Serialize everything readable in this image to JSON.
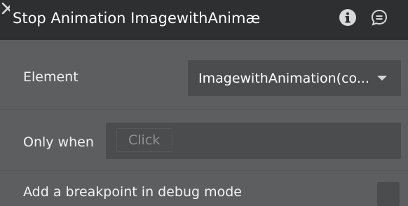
{
  "header": {
    "title": "Stop Animation ImagewithAnimæ",
    "icons": [
      "info-icon",
      "chat-icon",
      "close-icon"
    ]
  },
  "fields": {
    "element_label": "Element",
    "element_value": "ImagewithAnimation(co...",
    "only_when_label": "Only when",
    "only_when_placeholder": "Click",
    "breakpoint_label": "Add a breakpoint in debug mode",
    "breakpoint_checked": false
  },
  "colors": {
    "header_bg": "#2d2f31",
    "panel_bg": "#5c5e60",
    "input_bg": "#4a4c4e",
    "text": "#f2f2f2",
    "placeholder": "#8e9193"
  }
}
